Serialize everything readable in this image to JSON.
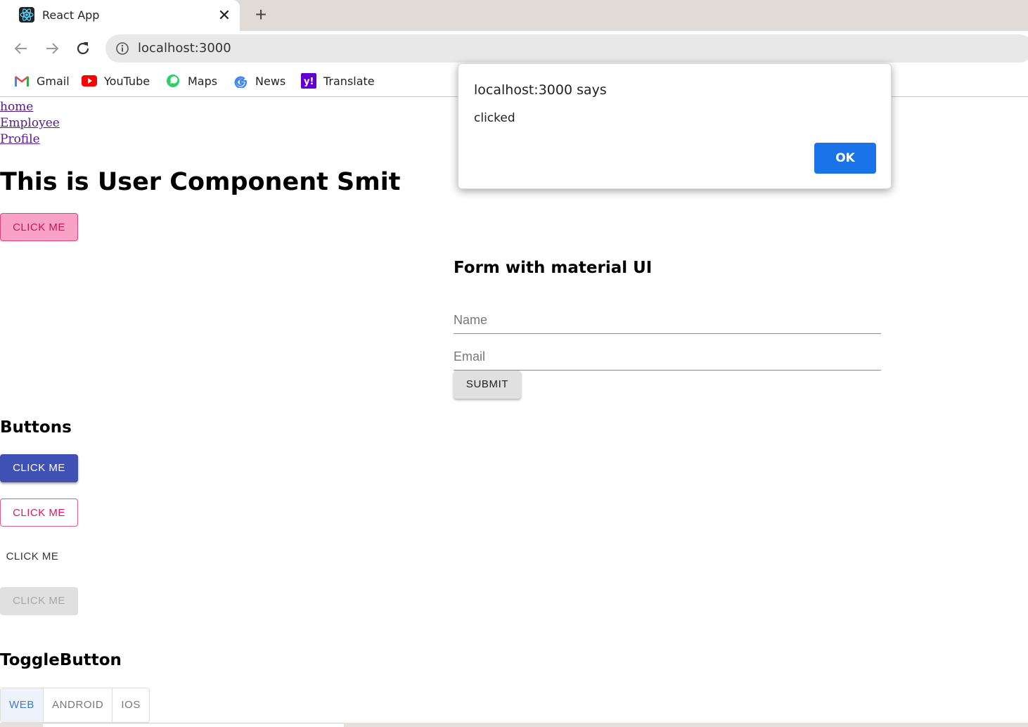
{
  "browser": {
    "tab_title": "React App",
    "url": "localhost:3000",
    "bookmarks": [
      "Gmail",
      "YouTube",
      "Maps",
      "News",
      "Translate"
    ]
  },
  "nav": {
    "links": [
      "home",
      "Employee",
      "Profile"
    ]
  },
  "main": {
    "heading": "This is User Component Smit",
    "pink_button": "CLICK ME"
  },
  "form": {
    "heading": "Form with material UI",
    "name_label": "Name",
    "email_label": "Email",
    "submit_label": "SUBMIT"
  },
  "buttons_section": {
    "heading": "Buttons",
    "contained_label": "CLICK ME",
    "outlined_label": "CLICK ME",
    "text_label": "CLICK ME",
    "disabled_label": "CLICK ME"
  },
  "toggle_section": {
    "heading": "ToggleButton",
    "options": [
      "WEB",
      "ANDROID",
      "IOS"
    ],
    "selected": "WEB"
  },
  "alert": {
    "title": "localhost:3000 says",
    "message": "clicked",
    "ok_label": "OK"
  },
  "colors": {
    "primary": "#3f51b5",
    "secondary": "#d81b60",
    "dialog_button": "#1a73e8"
  }
}
